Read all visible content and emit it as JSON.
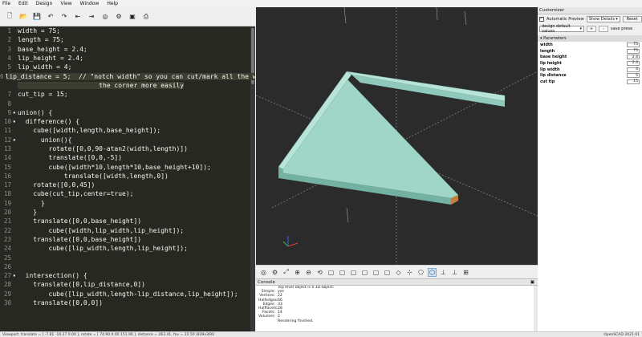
{
  "menu": [
    "File",
    "Edit",
    "Design",
    "View",
    "Window",
    "Help"
  ],
  "editor": {
    "lines": [
      {
        "n": "1",
        "fold": "",
        "text": "width = 75;"
      },
      {
        "n": "2",
        "fold": "",
        "text": "length = 75;"
      },
      {
        "n": "3",
        "fold": "",
        "text": "base_height = 2.4;"
      },
      {
        "n": "4",
        "fold": "",
        "text": "lip_height = 2.4;"
      },
      {
        "n": "5",
        "fold": "",
        "text": "lip_width = 4;"
      },
      {
        "n": "6",
        "fold": "",
        "text": "lip_distance = 5;  // \"notch width\" so you can cut/mark all the way to"
      },
      {
        "n": "",
        "fold": "",
        "text": "                     the corner more easily"
      },
      {
        "n": "7",
        "fold": "",
        "text": "cut_tip = 15;"
      },
      {
        "n": "8",
        "fold": "",
        "text": ""
      },
      {
        "n": "9",
        "fold": "▪",
        "text": "union() {"
      },
      {
        "n": "10",
        "fold": "▪",
        "text": "  difference() {"
      },
      {
        "n": "11",
        "fold": "",
        "text": "    cube([width,length,base_height]);"
      },
      {
        "n": "12",
        "fold": "▪",
        "text": "      union(){"
      },
      {
        "n": "13",
        "fold": "",
        "text": "        rotate([0,0,90-atan2(width,length)])"
      },
      {
        "n": "14",
        "fold": "",
        "text": "        translate([0,0,-5])"
      },
      {
        "n": "15",
        "fold": "",
        "text": "        cube([width*10,length*10,base_height+10]);"
      },
      {
        "n": "16",
        "fold": "",
        "text": "            translate([width,length,0])"
      },
      {
        "n": "17",
        "fold": "",
        "text": "    rotate([0,0,45])"
      },
      {
        "n": "18",
        "fold": "",
        "text": "    cube(cut_tip,center=true);"
      },
      {
        "n": "19",
        "fold": "",
        "text": "      }"
      },
      {
        "n": "20",
        "fold": "",
        "text": "    }"
      },
      {
        "n": "21",
        "fold": "",
        "text": "    translate([0,0,base_height])"
      },
      {
        "n": "22",
        "fold": "",
        "text": "        cube([width,lip_width,lip_height]);"
      },
      {
        "n": "23",
        "fold": "",
        "text": "    translate([0,0,base_height])"
      },
      {
        "n": "24",
        "fold": "",
        "text": "        cube([lip_width,length,lip_height]);"
      },
      {
        "n": "25",
        "fold": "",
        "text": ""
      },
      {
        "n": "26",
        "fold": "",
        "text": ""
      },
      {
        "n": "27",
        "fold": "▪",
        "text": "  intersection() {"
      },
      {
        "n": "28",
        "fold": "",
        "text": "    translate([0,lip_distance,0])"
      },
      {
        "n": "29",
        "fold": "",
        "text": "        cube([lip_width,length-lip_distance,lip_height]);"
      },
      {
        "n": "30",
        "fold": "",
        "text": "    translate([0,0,0])"
      }
    ]
  },
  "console": {
    "title": "Console",
    "rows": [
      {
        "k": "",
        "v": "Top level object is a 3D object:"
      },
      {
        "k": "Simple:",
        "v": "yes"
      },
      {
        "k": "Vertices:",
        "v": "22"
      },
      {
        "k": "Halfedges:",
        "v": "66"
      },
      {
        "k": "Edges:",
        "v": "33"
      },
      {
        "k": "Halffacets:",
        "v": "28"
      },
      {
        "k": "Facets:",
        "v": "14"
      },
      {
        "k": "Volumes:",
        "v": "2"
      },
      {
        "k": "",
        "v": "Rendering finished."
      }
    ]
  },
  "customizer": {
    "title": "Customizer",
    "auto_preview_label": "Automatic Preview",
    "show_details": "Show Details",
    "reset_label": "Reset",
    "preset": "design default values",
    "plus": "+",
    "minus": "-",
    "save_preset": "save prese",
    "params_header": "Parameters",
    "params": [
      {
        "name": "width",
        "value": "75"
      },
      {
        "name": "length",
        "value": "75"
      },
      {
        "name": "base height",
        "value": "2.4"
      },
      {
        "name": "lip height",
        "value": "2.4"
      },
      {
        "name": "lip width",
        "value": "4"
      },
      {
        "name": "lip distance",
        "value": "5"
      },
      {
        "name": "cut tip",
        "value": "15"
      }
    ]
  },
  "status": {
    "left": "Viewport: translate = [ -7.81 -10.27 0.00 ], rotate = [ 74.90 0.00 151.90 ], distance = 263.41, fov = 22.50 (839x360)",
    "right": "OpenSCAD 2021.01"
  },
  "colors": {
    "model": "#9fd6c8",
    "model_side": "#73b2a3",
    "viewport_bg": "#2b2b2b"
  }
}
